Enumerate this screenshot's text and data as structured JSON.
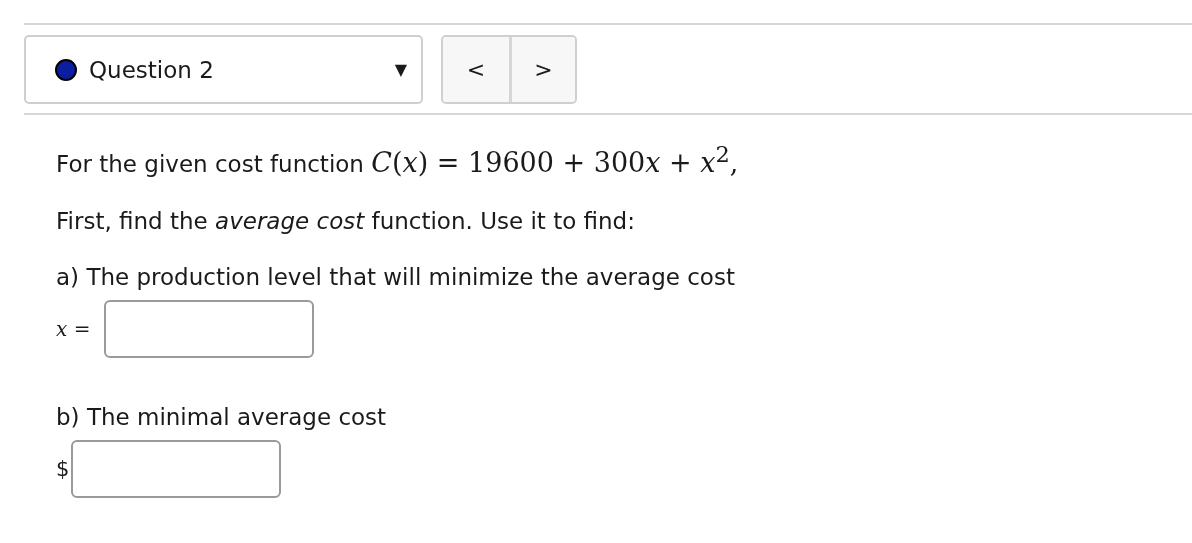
{
  "question_select": {
    "label": "Question 2",
    "caret": "▼"
  },
  "nav": {
    "prev": "<",
    "next": ">"
  },
  "intro": {
    "text": "For the given cost function",
    "formula": [
      "*C*(*x*) = 19600 + 300",
      "*x* + *x*$^{2}$,"
    ]
  },
  "instruction": "First, find the *average cost* function. Use it to find:",
  "parts": [
    {
      "prompt": "a) The production level that will minimize the average cost",
      "label": "*x* =",
      "kind": "math"
    },
    {
      "prompt": "b) The minimal average cost",
      "label": "$",
      "kind": "currency"
    }
  ]
}
